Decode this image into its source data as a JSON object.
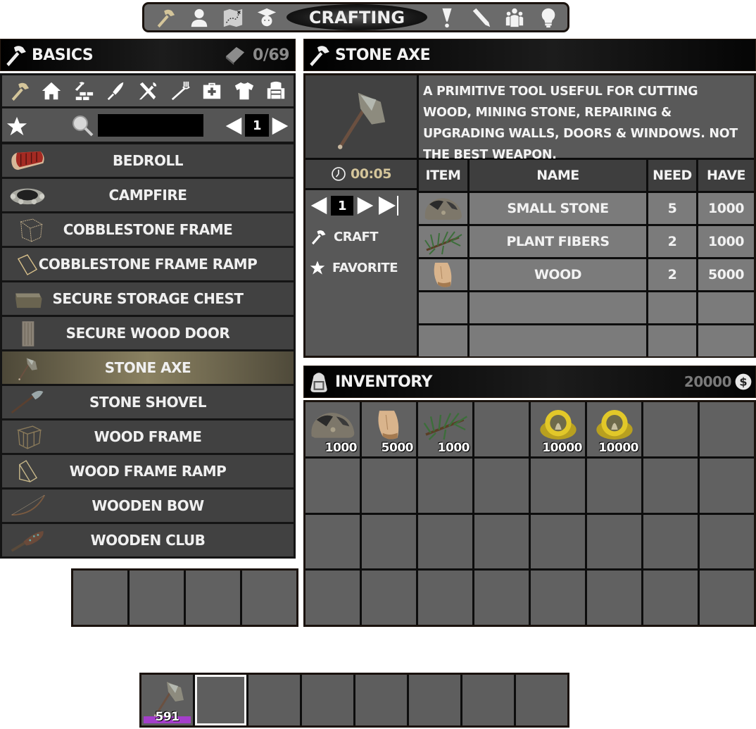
{
  "top_nav": {
    "title": "CRAFTING",
    "left_icons": [
      "hammer-icon",
      "character-icon",
      "map-icon",
      "skills-icon"
    ],
    "right_icons": [
      "quests-icon",
      "journal-pencil-icon",
      "players-icon",
      "tips-lightbulb-icon"
    ],
    "active_icon": "hammer-icon",
    "active_color": "#d4c59a"
  },
  "basics": {
    "title": "BASICS",
    "count": "0/69",
    "categories": [
      "basics",
      "building",
      "resources",
      "weapons",
      "tools",
      "food",
      "medical",
      "clothing",
      "decor"
    ],
    "active_category": "basics",
    "search": {
      "value": "",
      "placeholder": ""
    },
    "page": "1",
    "recipes": [
      {
        "label": "BEDROLL",
        "icon": "bedroll-icon"
      },
      {
        "label": "CAMPFIRE",
        "icon": "campfire-icon"
      },
      {
        "label": "COBBLESTONE FRAME",
        "icon": "cobblestone-frame-icon"
      },
      {
        "label": "COBBLESTONE FRAME RAMP",
        "icon": "cobblestone-frame-ramp-icon"
      },
      {
        "label": "SECURE STORAGE CHEST",
        "icon": "storage-chest-icon"
      },
      {
        "label": "SECURE WOOD DOOR",
        "icon": "wood-door-icon"
      },
      {
        "label": "STONE AXE",
        "icon": "stone-axe-icon",
        "selected": true
      },
      {
        "label": "STONE SHOVEL",
        "icon": "stone-shovel-icon"
      },
      {
        "label": "WOOD FRAME",
        "icon": "wood-frame-icon"
      },
      {
        "label": "WOOD FRAME RAMP",
        "icon": "wood-frame-ramp-icon"
      },
      {
        "label": "WOODEN BOW",
        "icon": "wooden-bow-icon"
      },
      {
        "label": "WOODEN CLUB",
        "icon": "wooden-club-icon"
      }
    ]
  },
  "detail": {
    "title": "STONE AXE",
    "description": "A PRIMITIVE TOOL USEFUL FOR CUTTING WOOD, MINING STONE, REPAIRING & UPGRADING WALLS, DOORS & WINDOWS. NOT THE BEST WEAPON.",
    "craft_time": "00:05",
    "quantity": "1",
    "craft_label": "CRAFT",
    "favorite_label": "FAVORITE",
    "table_headers": {
      "item": "ITEM",
      "name": "NAME",
      "need": "NEED",
      "have": "HAVE"
    },
    "ingredients": [
      {
        "name": "SMALL STONE",
        "need": "5",
        "have": "1000",
        "icon": "small-stone-icon"
      },
      {
        "name": "PLANT FIBERS",
        "need": "2",
        "have": "1000",
        "icon": "plant-fibers-icon"
      },
      {
        "name": "WOOD",
        "need": "2",
        "have": "5000",
        "icon": "wood-icon"
      },
      {
        "name": "",
        "need": "",
        "have": "",
        "icon": ""
      },
      {
        "name": "",
        "need": "",
        "have": "",
        "icon": ""
      }
    ]
  },
  "inventory": {
    "title": "INVENTORY",
    "money": "20000",
    "slots": [
      {
        "icon": "small-stone-icon",
        "qty": "1000"
      },
      {
        "icon": "wood-icon",
        "qty": "5000"
      },
      {
        "icon": "plant-fibers-icon",
        "qty": "1000"
      },
      {
        "icon": "",
        "qty": ""
      },
      {
        "icon": "casino-coin-icon",
        "qty": "10000"
      },
      {
        "icon": "casino-coin-icon",
        "qty": "10000"
      },
      {
        "icon": "",
        "qty": ""
      },
      {
        "icon": "",
        "qty": ""
      }
    ],
    "total_slots": 32
  },
  "tool_slots": {
    "count": 4
  },
  "toolbelt": {
    "slots": [
      {
        "icon": "stone-axe-icon",
        "qty": "591",
        "durability_color": "#a43ecb"
      },
      {
        "icon": "",
        "qty": "",
        "active": true
      },
      {
        "icon": "",
        "qty": ""
      },
      {
        "icon": "",
        "qty": ""
      },
      {
        "icon": "",
        "qty": ""
      },
      {
        "icon": "",
        "qty": ""
      },
      {
        "icon": "",
        "qty": ""
      },
      {
        "icon": "",
        "qty": ""
      }
    ]
  }
}
